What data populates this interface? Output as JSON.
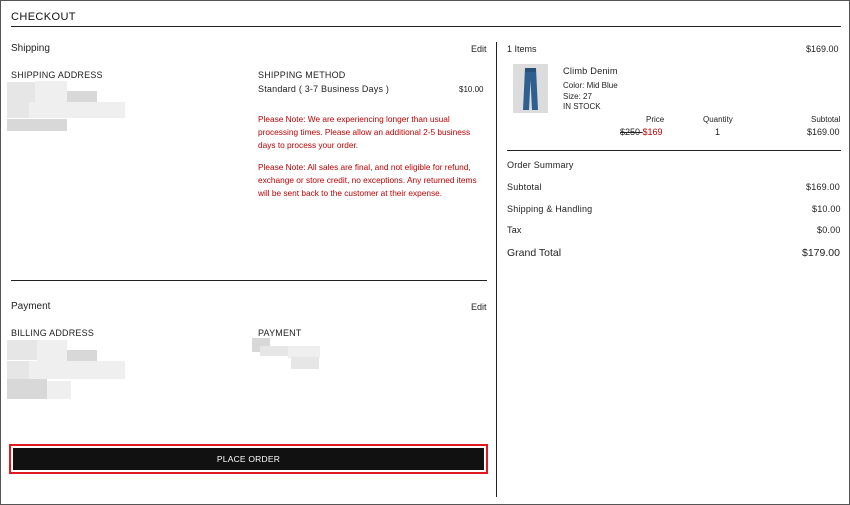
{
  "page": {
    "title": "CHECKOUT"
  },
  "shipping": {
    "section_title": "Shipping",
    "edit_label": "Edit",
    "address_label": "SHIPPING ADDRESS",
    "method_label": "SHIPPING METHOD",
    "method_name": "Standard ( 3-7 Business Days )",
    "method_price": "$10.00",
    "note_1": "Please Note: We are experiencing longer than usual processing times. Please allow an additional 2-5 business days to process your order.",
    "note_2": "Please Note: All sales are final, and not eligible for refund, exchange or store credit, no exceptions. Any returned items will be sent back to the customer at their expense."
  },
  "payment": {
    "section_title": "Payment",
    "edit_label": "Edit",
    "billing_label": "BILLING ADDRESS",
    "payment_label": "PAYMENT"
  },
  "place_order": {
    "label": "PLACE ORDER"
  },
  "cart": {
    "items_count": "1 Items",
    "items_total": "$169.00",
    "item": {
      "name": "Climb Denim",
      "color": "Color: Mid Blue",
      "size": "Size: 27",
      "stock": "IN STOCK",
      "price_header": "Price",
      "quantity_header": "Quantity",
      "subtotal_header": "Subtotal",
      "original_price": "$250 ",
      "sale_price": "$169",
      "quantity": "1",
      "subtotal": "$169.00"
    }
  },
  "summary": {
    "title": "Order Summary",
    "subtotal_label": "Subtotal",
    "subtotal_value": "$169.00",
    "shipping_label": "Shipping & Handling",
    "shipping_value": "$10.00",
    "tax_label": "Tax",
    "tax_value": "$0.00",
    "total_label": "Grand Total",
    "total_value": "$179.00"
  },
  "colors": {
    "accent_red": "#c00000",
    "button_bg": "#111111",
    "highlight_border": "#e0181f"
  }
}
